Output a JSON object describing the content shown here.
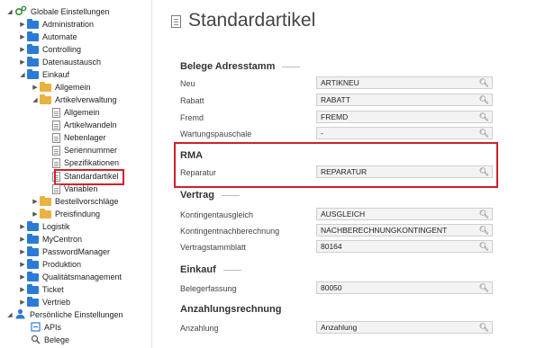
{
  "tree": {
    "root": "Globale Einstellungen",
    "items": [
      {
        "label": "Administration"
      },
      {
        "label": "Automate"
      },
      {
        "label": "Controlling"
      },
      {
        "label": "Datenaustausch"
      },
      {
        "label": "Einkauf"
      },
      {
        "label": "Allgemein"
      },
      {
        "label": "Artikelverwaltung"
      },
      {
        "label": "Allgemein"
      },
      {
        "label": "Artikelwandeln"
      },
      {
        "label": "Nebenlager"
      },
      {
        "label": "Seriennummer"
      },
      {
        "label": "Spezifikationen"
      },
      {
        "label": "Standardartikel"
      },
      {
        "label": "Variablen"
      },
      {
        "label": "Bestellvorschläge"
      },
      {
        "label": "Preisfindung"
      },
      {
        "label": "Logistik"
      },
      {
        "label": "MyCentron"
      },
      {
        "label": "PasswordManager"
      },
      {
        "label": "Produktion"
      },
      {
        "label": "Qualitätsmanagement"
      },
      {
        "label": "Ticket"
      },
      {
        "label": "Vertrieb"
      },
      {
        "label": "Persönliche Einstellungen"
      },
      {
        "label": "APIs"
      },
      {
        "label": "Belege"
      }
    ]
  },
  "page": {
    "title": "Standardartikel"
  },
  "sections": {
    "belege": {
      "title": "Belege Adresstamm",
      "fields": [
        {
          "label": "Neu",
          "value": "ARTIKNEU"
        },
        {
          "label": "Rabatt",
          "value": "RABATT"
        },
        {
          "label": "Fremd",
          "value": "FREMD"
        },
        {
          "label": "Wartungspauschale",
          "value": "-"
        }
      ]
    },
    "rma": {
      "title": "RMA",
      "fields": [
        {
          "label": "Reparatur",
          "value": "REPARATUR"
        }
      ]
    },
    "vertrag": {
      "title": "Vertrag",
      "fields": [
        {
          "label": "Kontingentausgleich",
          "value": "AUSGLEICH"
        },
        {
          "label": "Kontingentnachberechnung",
          "value": "NACHBERECHNUNGKONTINGENT"
        },
        {
          "label": "Vertragstammblatt",
          "value": "80164"
        }
      ]
    },
    "einkauf": {
      "title": "Einkauf",
      "fields": [
        {
          "label": "Belegerfassung",
          "value": "80050"
        }
      ]
    },
    "anzahlung": {
      "title": "Anzahlungsrechnung",
      "fields": [
        {
          "label": "Anzahlung",
          "value": "Anzahlung"
        }
      ]
    }
  }
}
